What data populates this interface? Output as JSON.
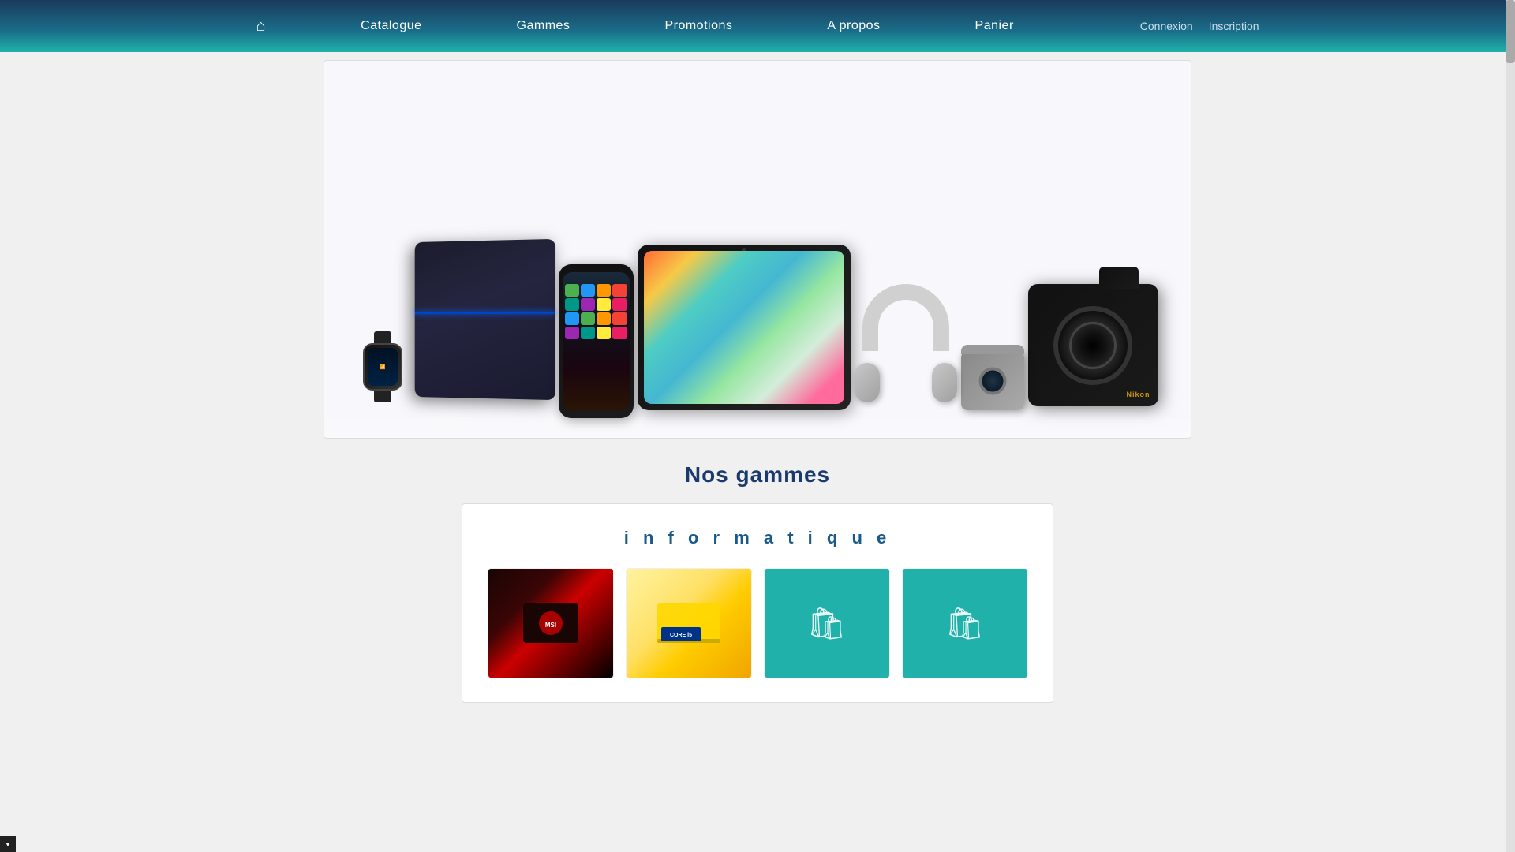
{
  "header": {
    "home_icon": "🏠",
    "nav_items": [
      {
        "label": "Catalogue",
        "id": "catalogue"
      },
      {
        "label": "Gammes",
        "id": "gammes"
      },
      {
        "label": "Promotions",
        "id": "promotions"
      },
      {
        "label": "A propos",
        "id": "a-propos"
      },
      {
        "label": "Panier",
        "id": "panier"
      }
    ],
    "auth": {
      "connexion": "Connexion",
      "inscription": "Inscription"
    }
  },
  "main": {
    "section_gammes_title": "Nos gammes",
    "category_informatique": "i n f o r m a t i q u e",
    "products": [
      {
        "id": "gaming",
        "type": "image",
        "alt": "Gaming laptop MSI"
      },
      {
        "id": "laptop",
        "type": "image",
        "alt": "Laptop with Intel Core i5"
      },
      {
        "id": "placeholder1",
        "type": "placeholder",
        "alt": "Product"
      },
      {
        "id": "placeholder2",
        "type": "placeholder",
        "alt": "Product"
      }
    ]
  },
  "icons": {
    "home": "⌂",
    "shopping_bag": "🛍"
  }
}
